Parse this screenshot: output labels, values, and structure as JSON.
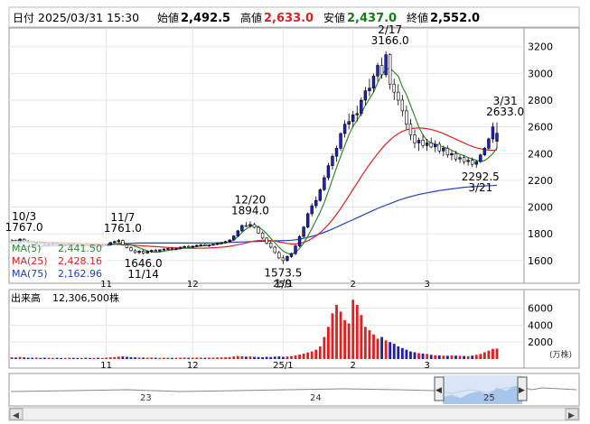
{
  "header": {
    "date_label": "日付",
    "date_value": "2025/03/31 15:30",
    "open_label": "始値",
    "open_value": "2,492.5",
    "high_label": "高値",
    "high_value": "2,633.0",
    "low_label": "安値",
    "low_value": "2,437.0",
    "close_label": "終値",
    "close_value": "2,552.0"
  },
  "colors": {
    "up": "#2020d0",
    "down": "#ffffff",
    "ma5": "#2e8b2e",
    "ma25": "#e02020",
    "ma75": "#2040c0",
    "vol_up": "#e02020",
    "vol_down": "#2020b0",
    "high_text": "#e02020",
    "low_text": "#108010"
  },
  "ma_legend": [
    {
      "label": "MA(5)",
      "value": "2,441.50"
    },
    {
      "label": "MA(25)",
      "value": "2,428.16"
    },
    {
      "label": "MA(75)",
      "value": "2,162.96"
    }
  ],
  "volume_legend": {
    "label": "出来高",
    "value": "12,306,500株"
  },
  "volume_unit": "(万株)",
  "navigator_labels": [
    "23",
    "24",
    "25"
  ],
  "chart_data": {
    "type": "candlestick",
    "price_axis": {
      "ticks": [
        1600,
        1800,
        2000,
        2200,
        2400,
        2600,
        2800,
        3000,
        3200
      ],
      "ylim": [
        1430,
        3340
      ]
    },
    "volume_axis": {
      "ticks": [
        2000,
        4000,
        6000
      ],
      "ylim": [
        0,
        8200
      ]
    },
    "month_labels": [
      {
        "label": "11",
        "index": 23
      },
      {
        "label": "12",
        "index": 44
      },
      {
        "label": "25/1",
        "index": 66
      },
      {
        "label": "2",
        "index": 83
      },
      {
        "label": "3",
        "index": 101
      }
    ],
    "annotations": [
      {
        "date": "10/3",
        "value": "1767.0",
        "index": 3,
        "price": 1767,
        "pos": "above"
      },
      {
        "date": "11/7",
        "value": "1761.0",
        "index": 27,
        "price": 1761,
        "pos": "above"
      },
      {
        "date": "11/14",
        "value": "1646.0",
        "index": 32,
        "price": 1646,
        "pos": "below"
      },
      {
        "date": "12/20",
        "value": "1894.0",
        "index": 58,
        "price": 1894,
        "pos": "above"
      },
      {
        "date": "1/9",
        "value": "1573.5",
        "index": 66,
        "price": 1573.5,
        "pos": "below"
      },
      {
        "date": "2/17",
        "value": "3166.0",
        "index": 92,
        "price": 3166,
        "pos": "above"
      },
      {
        "date": "3/21",
        "value": "2292.5",
        "index": 114,
        "price": 2292.5,
        "pos": "below"
      },
      {
        "date": "3/31",
        "value": "2633.0",
        "index": 120,
        "price": 2633,
        "pos": "above"
      }
    ],
    "candles": [
      [
        1740,
        1760,
        1720,
        1745
      ],
      [
        1745,
        1755,
        1725,
        1730
      ],
      [
        1730,
        1767,
        1725,
        1760
      ],
      [
        1760,
        1767,
        1735,
        1742
      ],
      [
        1742,
        1752,
        1728,
        1738
      ],
      [
        1738,
        1748,
        1720,
        1726
      ],
      [
        1726,
        1742,
        1718,
        1736
      ],
      [
        1736,
        1744,
        1722,
        1728
      ],
      [
        1728,
        1738,
        1712,
        1718
      ],
      [
        1718,
        1730,
        1705,
        1724
      ],
      [
        1724,
        1736,
        1716,
        1730
      ],
      [
        1730,
        1740,
        1718,
        1722
      ],
      [
        1722,
        1732,
        1708,
        1714
      ],
      [
        1714,
        1726,
        1702,
        1720
      ],
      [
        1720,
        1732,
        1712,
        1726
      ],
      [
        1726,
        1734,
        1714,
        1718
      ],
      [
        1718,
        1728,
        1706,
        1712
      ],
      [
        1712,
        1724,
        1700,
        1718
      ],
      [
        1718,
        1728,
        1708,
        1714
      ],
      [
        1714,
        1722,
        1700,
        1706
      ],
      [
        1706,
        1718,
        1696,
        1712
      ],
      [
        1712,
        1722,
        1702,
        1708
      ],
      [
        1708,
        1720,
        1698,
        1714
      ],
      [
        1714,
        1726,
        1706,
        1720
      ],
      [
        1720,
        1740,
        1712,
        1735
      ],
      [
        1735,
        1750,
        1726,
        1742
      ],
      [
        1742,
        1761,
        1734,
        1750
      ],
      [
        1750,
        1758,
        1712,
        1718
      ],
      [
        1718,
        1726,
        1690,
        1696
      ],
      [
        1696,
        1706,
        1668,
        1674
      ],
      [
        1674,
        1684,
        1652,
        1660
      ],
      [
        1660,
        1676,
        1648,
        1670
      ],
      [
        1670,
        1680,
        1646,
        1656
      ],
      [
        1656,
        1674,
        1650,
        1668
      ],
      [
        1668,
        1682,
        1658,
        1676
      ],
      [
        1676,
        1688,
        1664,
        1670
      ],
      [
        1670,
        1684,
        1662,
        1680
      ],
      [
        1680,
        1692,
        1672,
        1686
      ],
      [
        1686,
        1696,
        1676,
        1690
      ],
      [
        1690,
        1702,
        1680,
        1684
      ],
      [
        1684,
        1696,
        1676,
        1692
      ],
      [
        1692,
        1704,
        1684,
        1700
      ],
      [
        1700,
        1712,
        1692,
        1706
      ],
      [
        1706,
        1716,
        1696,
        1700
      ],
      [
        1700,
        1712,
        1692,
        1708
      ],
      [
        1708,
        1720,
        1700,
        1714
      ],
      [
        1714,
        1724,
        1704,
        1718
      ],
      [
        1718,
        1728,
        1708,
        1712
      ],
      [
        1712,
        1722,
        1702,
        1716
      ],
      [
        1716,
        1728,
        1708,
        1722
      ],
      [
        1722,
        1734,
        1714,
        1728
      ],
      [
        1728,
        1740,
        1720,
        1734
      ],
      [
        1734,
        1748,
        1726,
        1742
      ],
      [
        1742,
        1760,
        1734,
        1754
      ],
      [
        1754,
        1790,
        1748,
        1784
      ],
      [
        1784,
        1830,
        1776,
        1822
      ],
      [
        1822,
        1870,
        1814,
        1862
      ],
      [
        1862,
        1888,
        1850,
        1858
      ],
      [
        1858,
        1894,
        1846,
        1870
      ],
      [
        1870,
        1882,
        1840,
        1848
      ],
      [
        1848,
        1860,
        1800,
        1806
      ],
      [
        1806,
        1818,
        1760,
        1768
      ],
      [
        1768,
        1776,
        1720,
        1730
      ],
      [
        1730,
        1742,
        1690,
        1700
      ],
      [
        1700,
        1710,
        1650,
        1660
      ],
      [
        1660,
        1672,
        1610,
        1620
      ],
      [
        1620,
        1640,
        1573.5,
        1600
      ],
      [
        1600,
        1640,
        1590,
        1630
      ],
      [
        1630,
        1660,
        1620,
        1652
      ],
      [
        1652,
        1720,
        1640,
        1710
      ],
      [
        1710,
        1790,
        1700,
        1780
      ],
      [
        1780,
        1860,
        1770,
        1850
      ],
      [
        1850,
        1960,
        1840,
        1950
      ],
      [
        1950,
        2030,
        1930,
        2010
      ],
      [
        2010,
        2080,
        1990,
        2050
      ],
      [
        2050,
        2140,
        2040,
        2130
      ],
      [
        2130,
        2240,
        2120,
        2220
      ],
      [
        2220,
        2330,
        2200,
        2310
      ],
      [
        2310,
        2400,
        2280,
        2380
      ],
      [
        2380,
        2460,
        2340,
        2440
      ],
      [
        2440,
        2560,
        2420,
        2550
      ],
      [
        2550,
        2650,
        2520,
        2620
      ],
      [
        2620,
        2700,
        2580,
        2640
      ],
      [
        2640,
        2720,
        2600,
        2690
      ],
      [
        2690,
        2760,
        2640,
        2700
      ],
      [
        2700,
        2820,
        2680,
        2800
      ],
      [
        2800,
        2900,
        2760,
        2870
      ],
      [
        2870,
        2960,
        2830,
        2890
      ],
      [
        2890,
        3000,
        2860,
        2980
      ],
      [
        2980,
        3080,
        2940,
        3060
      ],
      [
        3060,
        3120,
        2960,
        2990
      ],
      [
        2990,
        3166,
        2970,
        3140
      ],
      [
        3140,
        3150,
        2880,
        2920
      ],
      [
        2920,
        2960,
        2800,
        2860
      ],
      [
        2860,
        2920,
        2760,
        2800
      ],
      [
        2800,
        2840,
        2680,
        2720
      ],
      [
        2720,
        2760,
        2580,
        2620
      ],
      [
        2620,
        2660,
        2500,
        2540
      ],
      [
        2540,
        2580,
        2440,
        2480
      ],
      [
        2480,
        2520,
        2420,
        2500
      ],
      [
        2500,
        2540,
        2440,
        2460
      ],
      [
        2460,
        2510,
        2420,
        2480
      ],
      [
        2480,
        2520,
        2440,
        2450
      ],
      [
        2450,
        2500,
        2410,
        2470
      ],
      [
        2470,
        2490,
        2400,
        2420
      ],
      [
        2420,
        2460,
        2380,
        2440
      ],
      [
        2440,
        2460,
        2370,
        2390
      ],
      [
        2390,
        2420,
        2350,
        2400
      ],
      [
        2400,
        2420,
        2340,
        2360
      ],
      [
        2360,
        2390,
        2330,
        2370
      ],
      [
        2370,
        2390,
        2320,
        2340
      ],
      [
        2340,
        2370,
        2310,
        2350
      ],
      [
        2350,
        2370,
        2300,
        2320
      ],
      [
        2320,
        2350,
        2292.5,
        2340
      ],
      [
        2340,
        2400,
        2330,
        2390
      ],
      [
        2390,
        2450,
        2380,
        2440
      ],
      [
        2440,
        2520,
        2430,
        2510
      ],
      [
        2510,
        2633,
        2480,
        2600
      ],
      [
        2492.5,
        2633,
        2437,
        2552
      ]
    ],
    "volume": [
      210,
      180,
      250,
      190,
      160,
      150,
      170,
      140,
      160,
      150,
      140,
      150,
      130,
      140,
      150,
      140,
      130,
      140,
      150,
      130,
      140,
      150,
      130,
      160,
      200,
      240,
      280,
      300,
      260,
      220,
      200,
      180,
      170,
      160,
      170,
      150,
      140,
      160,
      150,
      140,
      150,
      160,
      170,
      150,
      160,
      170,
      160,
      150,
      160,
      170,
      180,
      190,
      210,
      240,
      300,
      360,
      330,
      280,
      300,
      260,
      240,
      220,
      260,
      240,
      280,
      310,
      260,
      300,
      350,
      420,
      520,
      640,
      780,
      900,
      1100,
      1500,
      2600,
      3800,
      5400,
      6400,
      5600,
      4600,
      4200,
      7000,
      6400,
      5200,
      3800,
      3400,
      2900,
      2400,
      2600,
      2200,
      2000,
      1800,
      1500,
      1300,
      1100,
      900,
      800,
      700,
      650,
      600,
      500,
      450,
      420,
      400,
      380,
      420,
      400,
      380,
      360,
      340,
      400,
      500,
      600,
      800,
      1000,
      1200,
      1230
    ],
    "ma5": [
      1750,
      1748,
      1746,
      1745,
      1744,
      1740,
      1736,
      1733,
      1730,
      1726,
      1724,
      1724,
      1723,
      1721,
      1720,
      1719,
      1718,
      1717,
      1716,
      1715,
      1714,
      1712,
      1711,
      1712,
      1716,
      1722,
      1730,
      1733,
      1728,
      1718,
      1706,
      1695,
      1684,
      1672,
      1664,
      1662,
      1664,
      1670,
      1675,
      1680,
      1684,
      1688,
      1692,
      1696,
      1700,
      1704,
      1708,
      1712,
      1715,
      1718,
      1722,
      1726,
      1732,
      1740,
      1754,
      1778,
      1810,
      1836,
      1855,
      1862,
      1852,
      1830,
      1800,
      1766,
      1733,
      1700,
      1670,
      1655,
      1648,
      1660,
      1690,
      1730,
      1782,
      1840,
      1900,
      1962,
      2034,
      2118,
      2208,
      2296,
      2380,
      2460,
      2540,
      2604,
      2650,
      2700,
      2760,
      2810,
      2860,
      2930,
      2990,
      3030,
      3040,
      3010,
      2980,
      2900,
      2840,
      2760,
      2680,
      2600,
      2540,
      2500,
      2480,
      2470,
      2460,
      2450,
      2440,
      2425,
      2410,
      2395,
      2385,
      2370,
      2360,
      2350,
      2342,
      2348,
      2370,
      2400,
      2441.5
    ],
    "ma25": [
      1745,
      1744,
      1744,
      1743,
      1742,
      1741,
      1740,
      1739,
      1738,
      1737,
      1736,
      1735,
      1734,
      1733,
      1732,
      1731,
      1730,
      1729,
      1728,
      1727,
      1726,
      1725,
      1724,
      1723,
      1722,
      1721,
      1720,
      1719,
      1718,
      1716,
      1714,
      1712,
      1710,
      1708,
      1706,
      1704,
      1702,
      1700,
      1698,
      1696,
      1695,
      1694,
      1693,
      1692,
      1692,
      1692,
      1692,
      1693,
      1694,
      1696,
      1698,
      1700,
      1703,
      1707,
      1712,
      1718,
      1725,
      1732,
      1740,
      1746,
      1750,
      1752,
      1752,
      1750,
      1746,
      1740,
      1734,
      1728,
      1724,
      1724,
      1728,
      1736,
      1748,
      1764,
      1784,
      1808,
      1838,
      1870,
      1906,
      1946,
      1990,
      2036,
      2084,
      2132,
      2180,
      2228,
      2274,
      2318,
      2360,
      2400,
      2438,
      2472,
      2502,
      2528,
      2550,
      2566,
      2578,
      2586,
      2590,
      2592,
      2590,
      2586,
      2580,
      2572,
      2562,
      2550,
      2536,
      2522,
      2508,
      2494,
      2480,
      2466,
      2454,
      2444,
      2436,
      2430,
      2426,
      2425,
      2428.16
    ],
    "ma75": [
      1700,
      1701,
      1702,
      1703,
      1704,
      1705,
      1706,
      1707,
      1708,
      1709,
      1710,
      1711,
      1712,
      1713,
      1714,
      1715,
      1716,
      1717,
      1718,
      1719,
      1720,
      1721,
      1722,
      1723,
      1724,
      1725,
      1726,
      1727,
      1728,
      1729,
      1730,
      1731,
      1731,
      1731,
      1731,
      1731,
      1731,
      1731,
      1731,
      1731,
      1731,
      1731,
      1731,
      1731,
      1731,
      1731,
      1731,
      1731,
      1731,
      1732,
      1733,
      1734,
      1735,
      1736,
      1737,
      1738,
      1739,
      1740,
      1741,
      1742,
      1743,
      1744,
      1745,
      1746,
      1747,
      1748,
      1749,
      1750,
      1752,
      1755,
      1760,
      1766,
      1773,
      1781,
      1790,
      1800,
      1811,
      1823,
      1836,
      1850,
      1864,
      1878,
      1892,
      1906,
      1920,
      1934,
      1948,
      1962,
      1976,
      1990,
      2002,
      2014,
      2026,
      2038,
      2050,
      2060,
      2070,
      2078,
      2086,
      2094,
      2100,
      2106,
      2112,
      2118,
      2124,
      2128,
      2132,
      2136,
      2140,
      2144,
      2148,
      2150,
      2152,
      2154,
      2156,
      2158,
      2160,
      2161,
      2162.96
    ]
  }
}
